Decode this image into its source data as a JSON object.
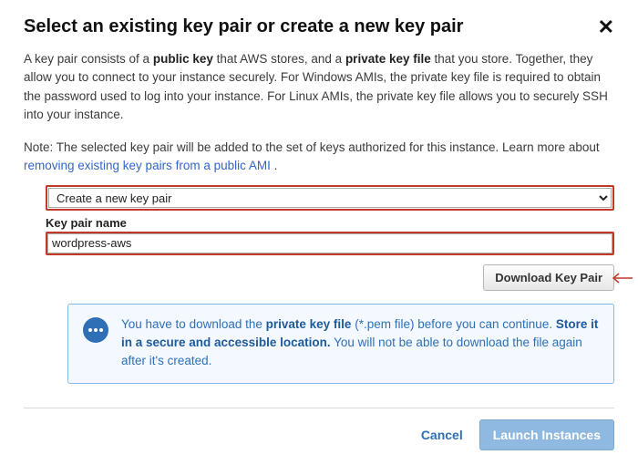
{
  "header": {
    "title": "Select an existing key pair or create a new key pair"
  },
  "description": {
    "pre": "A key pair consists of a ",
    "bold1": "public key",
    "mid1": " that AWS stores, and a ",
    "bold2": "private key file",
    "rest": " that you store. Together, they allow you to connect to your instance securely. For Windows AMIs, the private key file is required to obtain the password used to log into your instance. For Linux AMIs, the private key file allows you to securely SSH into your instance."
  },
  "note": {
    "text": "Note: The selected key pair will be added to the set of keys authorized for this instance. Learn more about ",
    "link_text": "removing existing key pairs from a public AMI",
    "period": " ."
  },
  "select": {
    "selected": "Create a new key pair"
  },
  "keypair": {
    "label": "Key pair name",
    "value": "wordpress-aws"
  },
  "buttons": {
    "download": "Download Key Pair",
    "cancel": "Cancel",
    "launch": "Launch Instances"
  },
  "info": {
    "pre": "You have to download the ",
    "bold1": "private key file",
    "mid": " (*.pem file) before you can continue. ",
    "bold2": "Store it in a secure and accessible location.",
    "rest": " You will not be able to download the file again after it's created."
  }
}
